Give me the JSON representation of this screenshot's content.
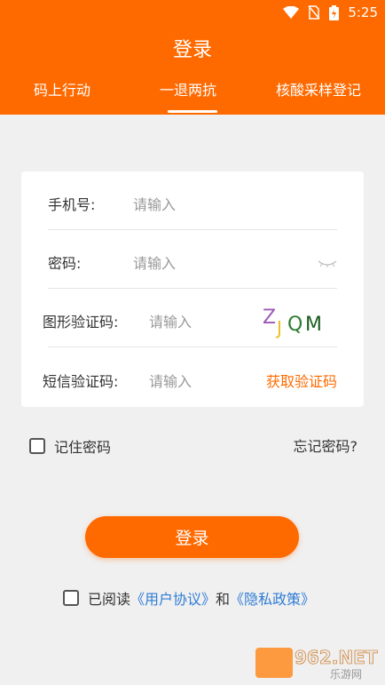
{
  "status": {
    "time": "5:25"
  },
  "header": {
    "title": "登录"
  },
  "tabs": [
    {
      "label": "码上行动"
    },
    {
      "label": "一退两抗"
    },
    {
      "label": "核酸采样登记"
    }
  ],
  "form": {
    "phone": {
      "label": "手机号:",
      "placeholder": "请输入"
    },
    "password": {
      "label": "密码:",
      "placeholder": "请输入"
    },
    "captcha": {
      "label": "图形验证码:",
      "placeholder": "请输入",
      "image_text": "ZJQM"
    },
    "sms": {
      "label": "短信验证码:",
      "placeholder": "请输入",
      "get_code": "获取验证码"
    }
  },
  "remember": {
    "label": "记住密码",
    "checked": false
  },
  "forgot": "忘记密码?",
  "login_button": "登录",
  "agreement": {
    "prefix": "已阅读",
    "user_agreement": "《用户协议》",
    "and": "和",
    "privacy": "《隐私政策》",
    "checked": false
  },
  "watermark": {
    "text1": "962.NET",
    "text2": "乐游网"
  },
  "colors": {
    "accent": "#ff6a00",
    "link": "#2f7cd6"
  }
}
